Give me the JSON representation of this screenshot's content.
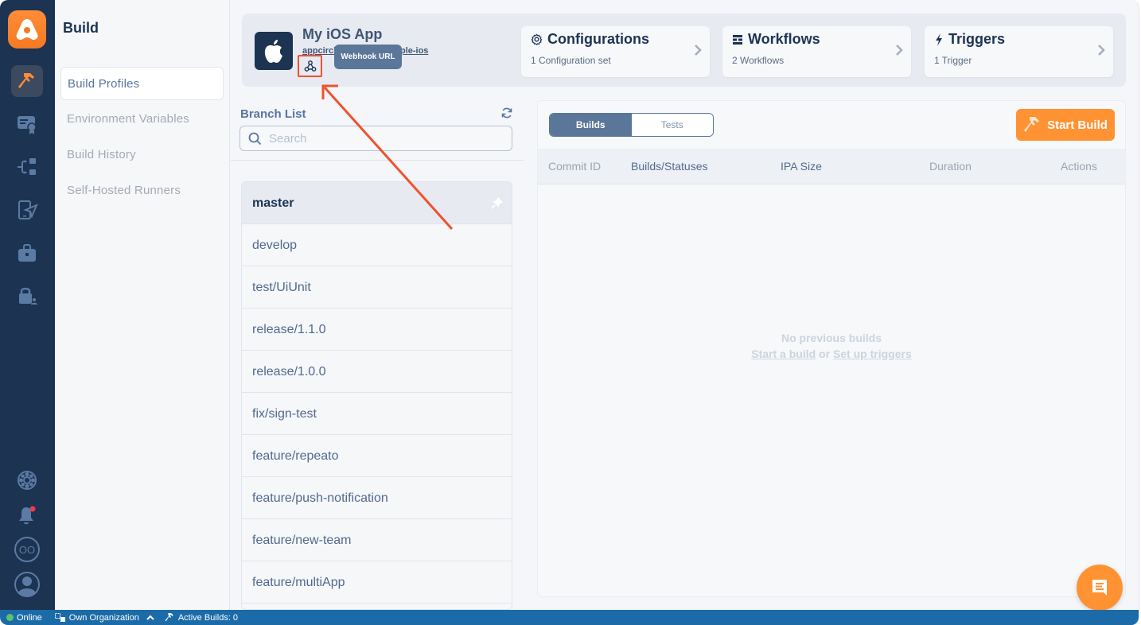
{
  "rail": {
    "items": [
      {
        "name": "build",
        "icon": "hammer-icon",
        "active": true
      },
      {
        "name": "signing-identities",
        "icon": "certificate-icon",
        "active": false
      },
      {
        "name": "distribution",
        "icon": "distribution-icon",
        "active": false
      },
      {
        "name": "testing-distribution",
        "icon": "device-send-icon",
        "active": false
      },
      {
        "name": "enterprise-store",
        "icon": "briefcase-icon",
        "active": false
      },
      {
        "name": "account-security",
        "icon": "lock-user-icon",
        "active": false
      }
    ],
    "bottom": [
      {
        "name": "help",
        "icon": "lifebuoy-icon"
      },
      {
        "name": "notifications",
        "icon": "bell-icon",
        "badge": true
      },
      {
        "name": "organization",
        "icon": "org-icon",
        "label": "OO"
      },
      {
        "name": "profile",
        "icon": "user-avatar-icon"
      }
    ]
  },
  "subnav": {
    "title": "Build",
    "items": [
      {
        "label": "Build Profiles",
        "active": true
      },
      {
        "label": "Environment Variables",
        "active": false
      },
      {
        "label": "Build History",
        "active": false
      },
      {
        "label": "Self-Hosted Runners",
        "active": false
      }
    ]
  },
  "header": {
    "app_name": "My iOS App",
    "repo": "appcircle-sample-ios",
    "repo_visible_left": "appcircl",
    "repo_visible_right": "mple-ios",
    "tooltip": "Webhook URL",
    "cards": [
      {
        "title": "Configurations",
        "subtitle": "1 Configuration set",
        "icon": "gear-icon"
      },
      {
        "title": "Workflows",
        "subtitle": "2 Workflows",
        "icon": "workflow-icon"
      },
      {
        "title": "Triggers",
        "subtitle": "1 Trigger",
        "icon": "lightning-icon"
      }
    ]
  },
  "branches": {
    "title": "Branch List",
    "search_placeholder": "Search",
    "search_value": "",
    "items": [
      {
        "label": "master",
        "selected": true,
        "pinned": true
      },
      {
        "label": "develop"
      },
      {
        "label": "test/UiUnit"
      },
      {
        "label": "release/1.1.0"
      },
      {
        "label": "release/1.0.0"
      },
      {
        "label": "fix/sign-test"
      },
      {
        "label": "feature/repeato"
      },
      {
        "label": "feature/push-notification"
      },
      {
        "label": "feature/new-team"
      },
      {
        "label": "feature/multiApp"
      }
    ]
  },
  "builds": {
    "tabs": [
      {
        "label": "Builds",
        "active": true
      },
      {
        "label": "Tests",
        "active": false
      }
    ],
    "start_build": "Start Build",
    "columns": [
      "Commit ID",
      "Builds/Statuses",
      "IPA Size",
      "Duration",
      "Actions"
    ],
    "empty_title": "No previous builds",
    "empty_link1": "Start a build",
    "empty_or": "or",
    "empty_link2": "Set up triggers"
  },
  "statusbar": {
    "online": "Online",
    "org": "Own Organization",
    "active_builds": "Active Builds: 0"
  },
  "colors": {
    "accent": "#ff9233",
    "rail": "#1c3352",
    "annotation": "#f0522e",
    "statusbar": "#1b6ba8"
  }
}
